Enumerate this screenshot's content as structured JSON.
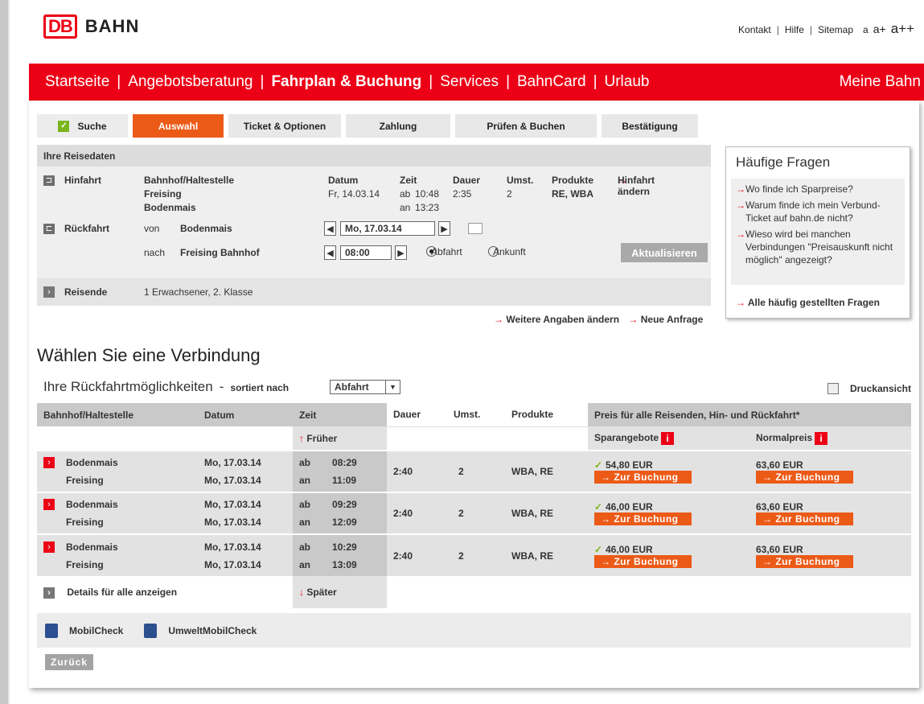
{
  "brand": {
    "logo_box": "DB",
    "logo_text": "BAHN"
  },
  "toplinks": {
    "kontakt": "Kontakt",
    "hilfe": "Hilfe",
    "sitemap": "Sitemap",
    "fs1": "a",
    "fs2": "a+",
    "fs3": "a++"
  },
  "nav": {
    "items": [
      "Startseite",
      "Angebotsberatung",
      "Fahrplan & Buchung",
      "Services",
      "BahnCard",
      "Urlaub"
    ],
    "right": "Meine Bahn"
  },
  "steps": [
    "Suche",
    "Auswahl",
    "Ticket & Optionen",
    "Zahlung",
    "Prüfen & Buchen",
    "Bestätigung"
  ],
  "reise": {
    "head": "Ihre Reisedaten",
    "hin_label": "Hinfahrt",
    "hin_station_head": "Bahnhof/Haltestelle",
    "hin_from": "Freising",
    "hin_to": "Bodenmais",
    "col_datum": "Datum",
    "col_zeit": "Zeit",
    "col_dauer": "Dauer",
    "col_umst": "Umst.",
    "col_produkte": "Produkte",
    "hin_datum": "Fr, 14.03.14",
    "hin_ab": "ab",
    "hin_ab_time": "10:48",
    "hin_an": "an",
    "hin_an_time": "13:23",
    "hin_dauer": "2:35",
    "hin_umst": "2",
    "hin_produkte": "RE, WBA",
    "hin_change": "Hinfahrt ändern",
    "rueck_label": "Rückfahrt",
    "von_label": "von",
    "von_value": "Bodenmais",
    "nach_label": "nach",
    "nach_value": "Freising Bahnhof",
    "date_value": "Mo, 17.03.14",
    "time_value": "08:00",
    "abfahrt": "Abfahrt",
    "ankunft": "Ankunft",
    "aktualisieren": "Aktualisieren",
    "reisende_label": "Reisende",
    "reisende_value": "1 Erwachsener, 2. Klasse"
  },
  "faq": {
    "title": "Häufige Fragen",
    "items": [
      "Wo finde ich Sparpreise?",
      "Warum finde ich mein Verbund-Ticket auf bahn.de nicht?",
      "Wieso wird bei manchen Verbindungen \"Preisauskunft nicht möglich\" angezeigt?"
    ],
    "all": "Alle häufig gestellten Fragen"
  },
  "links": {
    "weitere": "Weitere Angaben ändern",
    "neue": "Neue Anfrage"
  },
  "main": {
    "title": "Wählen Sie eine Verbindung",
    "subtitle": "Ihre Rückfahrtmöglichkeiten",
    "dash": "-",
    "sorted": "sortiert nach",
    "sort_value": "Abfahrt",
    "druck": "Druckansicht"
  },
  "table": {
    "headers": [
      "Bahnhof/Haltestelle",
      "Datum",
      "Zeit",
      "Dauer",
      "Umst.",
      "Produkte",
      "Preis für alle Reisenden, Hin- und Rückfahrt*"
    ],
    "frueher": "Früher",
    "spar": "Sparangebote",
    "normal": "Normalpreis",
    "book": "→ Zur Buchung",
    "rows": [
      {
        "from": "Bodenmais",
        "to": "Freising",
        "date1": "Mo, 17.03.14",
        "date2": "Mo, 17.03.14",
        "ab": "ab",
        "an": "an",
        "t1": "08:29",
        "t2": "11:09",
        "dauer": "2:40",
        "umst": "2",
        "produkte": "WBA, RE",
        "spar": "54,80 EUR",
        "normal": "63,60 EUR"
      },
      {
        "from": "Bodenmais",
        "to": "Freising",
        "date1": "Mo, 17.03.14",
        "date2": "Mo, 17.03.14",
        "ab": "ab",
        "an": "an",
        "t1": "09:29",
        "t2": "12:09",
        "dauer": "2:40",
        "umst": "2",
        "produkte": "WBA, RE",
        "spar": "46,00 EUR",
        "normal": "63,60 EUR"
      },
      {
        "from": "Bodenmais",
        "to": "Freising",
        "date1": "Mo, 17.03.14",
        "date2": "Mo, 17.03.14",
        "ab": "ab",
        "an": "an",
        "t1": "10:29",
        "t2": "13:09",
        "dauer": "2:40",
        "umst": "2",
        "produkte": "WBA, RE",
        "spar": "46,00 EUR",
        "normal": "63,60 EUR"
      }
    ],
    "details": "Details für alle anzeigen",
    "spaeter": "Später"
  },
  "footer": {
    "mobil": "MobilCheck",
    "umwelt": "UmweltMobilCheck",
    "zurueck": "Zurück"
  }
}
